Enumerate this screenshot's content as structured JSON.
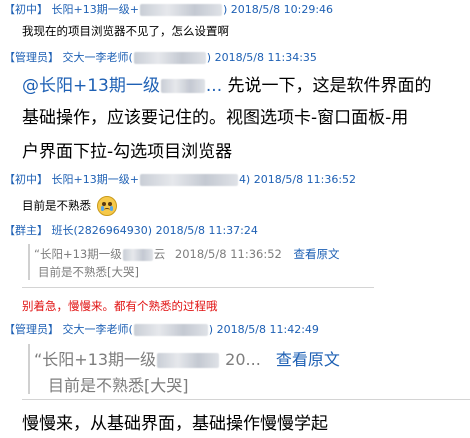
{
  "messages": [
    {
      "role": "【初中】",
      "sender": "长阳+13期一级+",
      "sender_suffix": ")",
      "time": "2018/5/8 10:29:46",
      "text": "我现在的项目浏览器不见了，怎么设置啊"
    },
    {
      "role": "【管理员】",
      "sender": "交大一李老师(",
      "sender_suffix": ")",
      "time": "2018/5/8 11:34:35",
      "mention": "@长阳+13期一级",
      "mention_tail": "...",
      "text_first": "先说一下，这是软件界面的",
      "text_lines": [
        "基础操作，应该要记住的。视图选项卡-窗口面板-用",
        "户界面下拉-勾选项目浏览器"
      ]
    },
    {
      "role": "【初中】",
      "sender": "长阳+13期一级+",
      "sender_suffix": "4)",
      "time": "2018/5/8 11:36:52",
      "text": "目前是不熟悉",
      "emoji": "crying-face"
    },
    {
      "role": "【群主】",
      "sender": "班长(2826964930)",
      "time": "2018/5/8 11:37:24",
      "quote_sender": "“长阳+13期一级",
      "quote_sender_tail": "云",
      "quote_time": "2018/5/8 11:36:52",
      "quote_link": "查看原文",
      "quote_text": "目前是不熟悉[大哭]",
      "text": "别着急，慢慢来。都有个熟悉的过程哦"
    },
    {
      "role": "【管理员】",
      "sender": "交大一李老师(",
      "sender_suffix": ")",
      "time": "2018/5/8 11:42:49",
      "quote_sender": "“长阳+13期一级",
      "quote_time_partial": "20...",
      "quote_link": "查看原文",
      "quote_text": "目前是不熟悉[大哭]",
      "text": "慢慢来，从基础界面，基础操作慢慢学起"
    }
  ]
}
